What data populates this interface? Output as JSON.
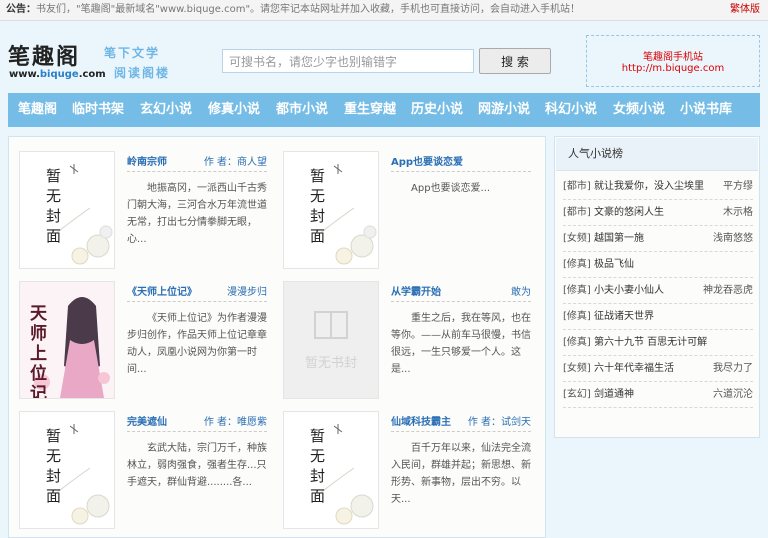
{
  "notice": {
    "label": "公告：",
    "text": "书友们，\"笔趣阁\"最新域名\"www.biquge.com\"。请您牢记本站网址并加入收藏，手机也可直接访问，会自动进入手机站！",
    "traditional": "繁体版"
  },
  "header": {
    "logo": "笔趣阁",
    "logo_url_prefix": "www.",
    "logo_url_brand": "biquge",
    "logo_url_suffix": ".com",
    "slogan_line1": "笔下文学",
    "slogan_line2": "阅读阁楼",
    "search_placeholder": "可搜书名，请您少字也别输错字",
    "search_button": "搜 索",
    "mobile_title": "笔趣阁手机站",
    "mobile_url": "http://m.biquge.com"
  },
  "nav": [
    "笔趣阁",
    "临时书架",
    "玄幻小说",
    "修真小说",
    "都市小说",
    "重生穿越",
    "历史小说",
    "网游小说",
    "科幻小说",
    "女频小说",
    "小说书库"
  ],
  "covers": {
    "placeholder_text": "暂无封面",
    "no_cover_text": "暂无书封",
    "tianshi_title": "天师上位记"
  },
  "books": [
    {
      "title": "岭南宗师",
      "author": "作 者：商人望",
      "desc": "地振高冈，一派西山千古秀门朝大海，三河合水万年流世道无常，打出七分情拳脚无眼，心..."
    },
    {
      "title": "App也要谈恋爱",
      "author": "",
      "desc": "App也要谈恋爱..."
    },
    {
      "title": "《天师上位记》",
      "author": "漫漫步归",
      "desc": "《天师上位记》为作者漫漫步归创作，作品天师上位记章章动人，凤凰小说网为你第一时间..."
    },
    {
      "title": "从学霸开始",
      "author": "敢为",
      "desc": "重生之后，我在等风，也在等你。——从前车马很慢，书信很远，一生只够爱一个人。这是..."
    },
    {
      "title": "完美遮仙",
      "author": "作 者：唯愿紫",
      "desc": "玄武大陆，宗门万千，种族林立，弱肉强食，强者生存...只手遮天，群仙背避........各..."
    },
    {
      "title": "仙域科技霸主",
      "author": "作 者：试剑天",
      "desc": "百千万年以来，仙法完全流入民间，群雄并起；新思想、新形势、新事物，层出不穷。以天..."
    }
  ],
  "sidebar": {
    "title": "人气小说榜",
    "items": [
      {
        "cat": "[都市]",
        "name": "就让我爱你，没入尘埃里",
        "author": "平方缪"
      },
      {
        "cat": "[都市]",
        "name": "文豪的悠闲人生",
        "author": "木示格"
      },
      {
        "cat": "[女频]",
        "name": "越国第一施",
        "author": "浅南悠悠"
      },
      {
        "cat": "[修真]",
        "name": "极品飞仙",
        "author": ""
      },
      {
        "cat": "[修真]",
        "name": "小夫小妻小仙人",
        "author": "神龙吞恶虎"
      },
      {
        "cat": "[修真]",
        "name": "征战诸天世界",
        "author": ""
      },
      {
        "cat": "[修真]",
        "name": "第六十九节 百思无计可解",
        "author": ""
      },
      {
        "cat": "[女频]",
        "name": "六十年代幸福生活",
        "author": "我尽力了"
      },
      {
        "cat": "[玄幻]",
        "name": "剑道通神",
        "author": "六道沉沦"
      }
    ]
  }
}
